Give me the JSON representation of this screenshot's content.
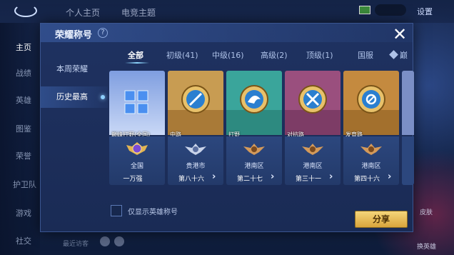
{
  "background": {
    "tabs": [
      "个人主页",
      "电竞主题"
    ],
    "settings": "设置",
    "side_items": [
      "主页",
      "战绩",
      "英雄",
      "图鉴",
      "荣誉",
      "护卫队",
      "游戏",
      "社交"
    ],
    "bottom_text": "最近访客",
    "right_labels": [
      "皮肤",
      "换英雄"
    ]
  },
  "modal": {
    "title": "荣耀称号",
    "help": "?",
    "close": "✕"
  },
  "nav": {
    "items": [
      {
        "label": "本周荣耀"
      },
      {
        "label": "历史最高"
      }
    ]
  },
  "tabs": [
    {
      "label": "全部"
    },
    {
      "label": "初级(41)"
    },
    {
      "label": "中级(16)"
    },
    {
      "label": "高级(2)"
    },
    {
      "label": "顶级(1)"
    },
    {
      "label": "国服"
    },
    {
      "label": "巅"
    }
  ],
  "cards": [
    {
      "label": "巅峰打野(全国)",
      "region": "全国",
      "rank": "一万强",
      "theme": "#9fb8ec"
    },
    {
      "label": "中路",
      "region": "贵港市",
      "rank": "第八十六",
      "theme": "#c89c52"
    },
    {
      "label": "打野",
      "region": "港南区",
      "rank": "第二十七",
      "theme": "#3aa59b"
    },
    {
      "label": "对抗路",
      "region": "港南区",
      "rank": "第三十一",
      "theme": "#9a4f7e"
    },
    {
      "label": "发育路",
      "region": "港南区",
      "rank": "第四十六",
      "theme": "#c48a3f"
    }
  ],
  "filter": {
    "label": "仅显示英雄称号"
  },
  "share": {
    "label": "分享"
  },
  "colors": {
    "accent": "#8fd8ff",
    "gold": "#e3b453"
  }
}
